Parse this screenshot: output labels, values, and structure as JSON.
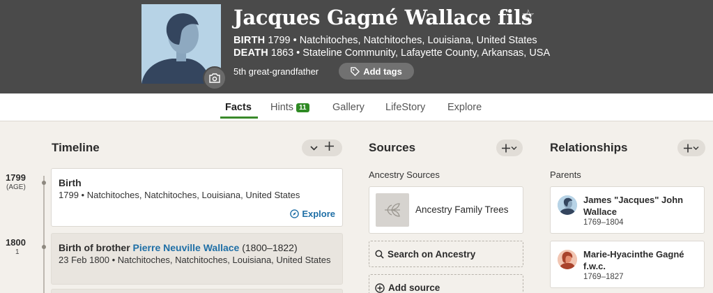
{
  "person": {
    "name": "Jacques Gagné Wallace fils",
    "birth_label": "BIRTH",
    "birth_value": "1799 • Natchitoches, Natchitoches, Louisiana, United States",
    "death_label": "DEATH",
    "death_value": "1863 • Stateline Community, Lafayette County, Arkansas, USA",
    "relation": "5th great-grandfather",
    "add_tags_label": "Add tags",
    "star_icon": "☆"
  },
  "nav": {
    "tabs": [
      {
        "label": "Facts",
        "active": true
      },
      {
        "label": "Hints",
        "badge": "11"
      },
      {
        "label": "Gallery"
      },
      {
        "label": "LifeStory"
      },
      {
        "label": "Explore"
      }
    ]
  },
  "timeline": {
    "title": "Timeline",
    "events": [
      {
        "year": "1799",
        "age": "(AGE)",
        "title": "Birth",
        "detail": "1799 • Natchitoches, Natchitoches, Louisiana, United States",
        "explore_label": "Explore"
      },
      {
        "year": "1800",
        "age": "1",
        "title_prefix": "Birth of brother ",
        "title_link": "Pierre Neuville Wallace",
        "title_suffix": " (1800–1822)",
        "detail": "23 Feb 1800 • Natchitoches, Natchitoches, Louisiana, United States"
      }
    ]
  },
  "sources": {
    "title": "Sources",
    "subtitle": "Ancestry Sources",
    "items": [
      {
        "label": "Ancestry Family Trees"
      }
    ],
    "search_label": "Search on Ancestry",
    "add_label": "Add source"
  },
  "relationships": {
    "title": "Relationships",
    "subtitle": "Parents",
    "parents": [
      {
        "name": "James \"Jacques\" John Wallace",
        "dates": "1769–1804",
        "avatar_color": "#b7d3e6"
      },
      {
        "name": "Marie-Hyacinthe Gagné f.w.c.",
        "dates": "1769–1827",
        "avatar_color": "#f2c6b3"
      }
    ]
  },
  "colors": {
    "header_bg": "#4a4a4a",
    "accent_green": "#2f8a24",
    "link_blue": "#1f6fa6"
  }
}
